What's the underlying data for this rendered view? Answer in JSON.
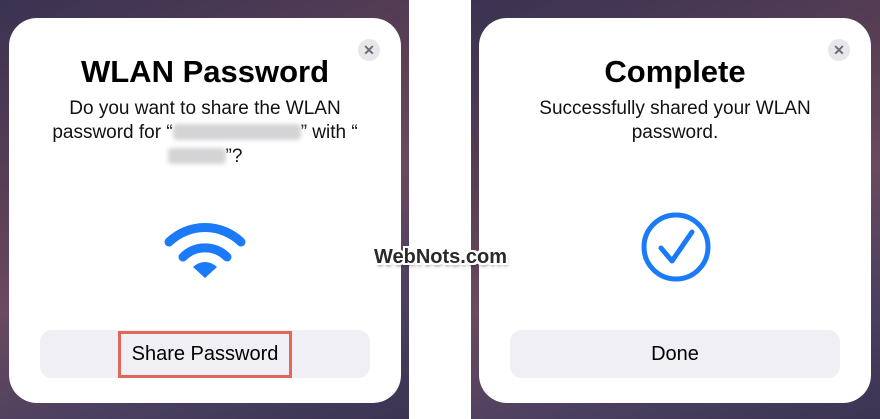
{
  "colors": {
    "accent": "#1a7af8",
    "highlight_border": "#e0675d",
    "button_bg": "#efeff4"
  },
  "share_dialog": {
    "title": "WLAN Password",
    "message_part1": "Do you want to share the WLAN password for “",
    "message_part2": "” with “",
    "message_part3": "”?",
    "close_icon": "✕",
    "icon": "wifi-icon",
    "button_label": "Share Password"
  },
  "complete_dialog": {
    "title": "Complete",
    "message": "Successfully shared your WLAN password.",
    "close_icon": "✕",
    "icon": "checkmark-circle-icon",
    "button_label": "Done"
  },
  "watermark": "WebNots.com"
}
